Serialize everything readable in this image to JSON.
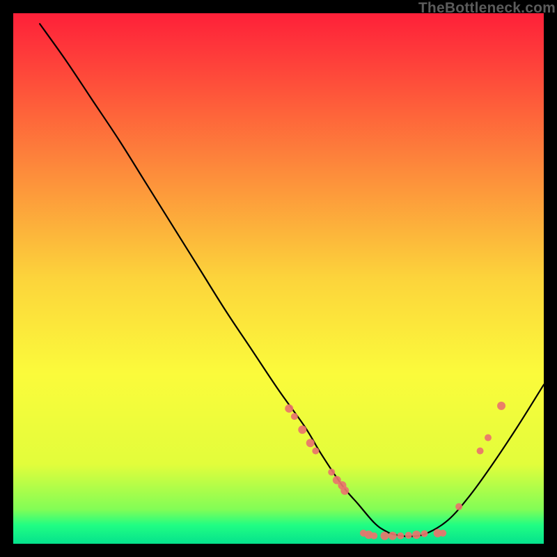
{
  "watermark": "TheBottleneck.com",
  "chart_data": {
    "type": "line",
    "title": "",
    "xlabel": "",
    "ylabel": "",
    "xlim": [
      0,
      100
    ],
    "ylim": [
      0,
      100
    ],
    "curve": {
      "name": "bottleneck-curve",
      "x": [
        5,
        10,
        15,
        20,
        25,
        30,
        35,
        40,
        45,
        50,
        55,
        58,
        62,
        65,
        68,
        70,
        72,
        75,
        78,
        82,
        86,
        90,
        95,
        100
      ],
      "y": [
        98,
        91,
        83.5,
        76,
        68,
        60,
        52,
        44,
        36.5,
        29,
        22,
        17,
        11,
        7.5,
        4,
        2.5,
        1.7,
        1.4,
        2,
        4.5,
        9,
        14.5,
        22,
        30
      ]
    },
    "markers": {
      "name": "highlight-points",
      "color": "#e9746c",
      "points": [
        {
          "x": 52,
          "y": 25.5,
          "r": 6
        },
        {
          "x": 53,
          "y": 24,
          "r": 5
        },
        {
          "x": 54.5,
          "y": 21.5,
          "r": 6
        },
        {
          "x": 56,
          "y": 19,
          "r": 6
        },
        {
          "x": 57,
          "y": 17.5,
          "r": 5
        },
        {
          "x": 60,
          "y": 13.5,
          "r": 5
        },
        {
          "x": 61,
          "y": 12.0,
          "r": 6
        },
        {
          "x": 62,
          "y": 11.0,
          "r": 6
        },
        {
          "x": 62.5,
          "y": 10.0,
          "r": 6
        },
        {
          "x": 66,
          "y": 2.0,
          "r": 5
        },
        {
          "x": 67,
          "y": 1.7,
          "r": 6
        },
        {
          "x": 68,
          "y": 1.5,
          "r": 5
        },
        {
          "x": 70,
          "y": 1.5,
          "r": 6
        },
        {
          "x": 71.5,
          "y": 1.5,
          "r": 6
        },
        {
          "x": 73,
          "y": 1.5,
          "r": 5
        },
        {
          "x": 74.5,
          "y": 1.6,
          "r": 5
        },
        {
          "x": 76,
          "y": 1.7,
          "r": 6
        },
        {
          "x": 77.5,
          "y": 1.9,
          "r": 5
        },
        {
          "x": 80,
          "y": 2.0,
          "r": 6
        },
        {
          "x": 81,
          "y": 2.0,
          "r": 5
        },
        {
          "x": 84,
          "y": 7.0,
          "r": 5
        },
        {
          "x": 88,
          "y": 17.5,
          "r": 5
        },
        {
          "x": 89.5,
          "y": 20,
          "r": 5
        },
        {
          "x": 92,
          "y": 26,
          "r": 6
        }
      ]
    },
    "background": {
      "type": "vertical-gradient",
      "stops": [
        {
          "offset": 0.0,
          "color": "#fe2039"
        },
        {
          "offset": 0.1,
          "color": "#fe433a"
        },
        {
          "offset": 0.3,
          "color": "#fd8c3b"
        },
        {
          "offset": 0.5,
          "color": "#fcd43b"
        },
        {
          "offset": 0.68,
          "color": "#fbfb3b"
        },
        {
          "offset": 0.85,
          "color": "#e2fd3b"
        },
        {
          "offset": 0.935,
          "color": "#82fd56"
        },
        {
          "offset": 0.965,
          "color": "#20fd83"
        },
        {
          "offset": 1.0,
          "color": "#05e28d"
        }
      ]
    }
  }
}
